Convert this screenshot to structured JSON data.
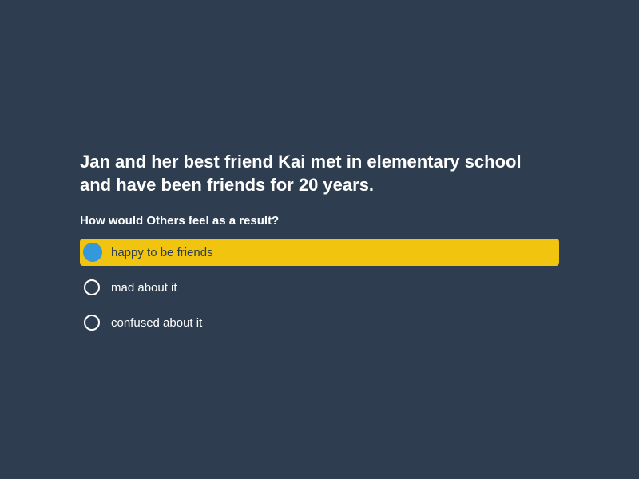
{
  "question": {
    "title": "Jan and her best friend Kai met in elementary school and have been friends for 20 years.",
    "prompt": "How would Others feel as a result?"
  },
  "options": [
    {
      "label": "happy to be friends",
      "selected": true
    },
    {
      "label": "mad about it",
      "selected": false
    },
    {
      "label": "confused about it",
      "selected": false
    }
  ],
  "colors": {
    "background": "#2e3e50",
    "selected_background": "#f1c40f",
    "selected_radio": "#3498db",
    "text": "#ffffff"
  }
}
